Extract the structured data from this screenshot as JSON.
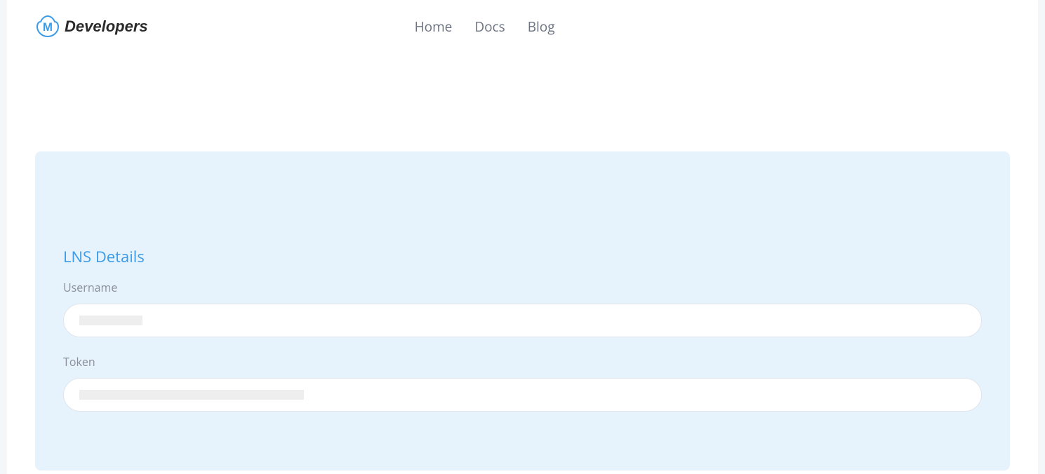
{
  "header": {
    "logo_text": "Developers",
    "nav": {
      "home": "Home",
      "docs": "Docs",
      "blog": "Blog"
    }
  },
  "card": {
    "title": "LNS Details",
    "username_label": "Username",
    "username_value": "",
    "token_label": "Token",
    "token_value": ""
  }
}
